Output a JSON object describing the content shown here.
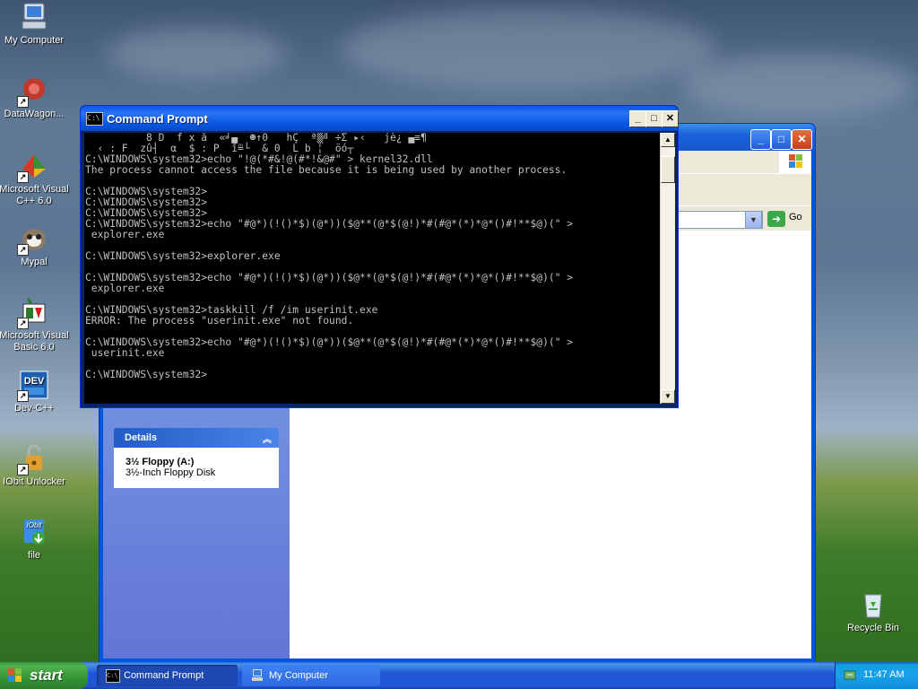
{
  "desktop": {
    "icons": [
      {
        "label": "My Computer",
        "icon": "my-computer-icon"
      },
      {
        "label": "DataWagon...",
        "icon": "datawagon-icon"
      },
      {
        "label": "Microsoft Visual C++ 6.0",
        "icon": "visual-cpp-icon"
      },
      {
        "label": "Mypal",
        "icon": "mypal-icon"
      },
      {
        "label": "Microsoft Visual Basic 6.0",
        "icon": "visual-basic-icon"
      },
      {
        "label": "Dev-C++",
        "icon": "devcpp-icon"
      },
      {
        "label": "IObit Unlocker",
        "icon": "iobit-unlocker-icon"
      },
      {
        "label": "file",
        "icon": "file-icon"
      },
      {
        "label": "Recycle Bin",
        "icon": "recycle-bin-icon"
      }
    ]
  },
  "cmd_window": {
    "title": "Command Prompt",
    "icon_text": "C:\\",
    "lines": [
      "          8 D  f x å  «╛▄  ☻↑0   hÇ  ª▒╝ ÷Σ ▸‹   jè¿ ▄≡¶",
      "  ‹ : F  zû┤  α  $ : P  î≞└  & 0  L b ╎  öó┬  ",
      "C:\\WINDOWS\\system32>echo \"!@(*#&!@(#*!&@#\" > kernel32.dll",
      "The process cannot access the file because it is being used by another process.",
      "",
      "C:\\WINDOWS\\system32>",
      "C:\\WINDOWS\\system32>",
      "C:\\WINDOWS\\system32>",
      "C:\\WINDOWS\\system32>echo \"#@*)(!()*$)(@*))($@**(@*$(@!)*#(#@*(*)*@*()#!**$@)(\" >",
      " explorer.exe",
      "",
      "C:\\WINDOWS\\system32>explorer.exe",
      "",
      "C:\\WINDOWS\\system32>echo \"#@*)(!()*$)(@*))($@**(@*$(@!)*#(#@*(*)*@*()#!**$@)(\" >",
      " explorer.exe",
      "",
      "C:\\WINDOWS\\system32>taskkill /f /im userinit.exe",
      "ERROR: The process \"userinit.exe\" not found.",
      "",
      "C:\\WINDOWS\\system32>echo \"#@*)(!()*$)(@*))($@**(@*$(@!)*#(#@*(*)*@*()#!**$@)(\" >",
      " userinit.exe",
      "",
      "C:\\WINDOWS\\system32>"
    ],
    "minimize": "_",
    "maximize": "□",
    "close": "✕"
  },
  "explorer_window": {
    "address_go": "Go",
    "details": {
      "header": "Details",
      "name": "3½ Floppy (A:)",
      "type": "3½-Inch Floppy Disk"
    }
  },
  "taskbar": {
    "start_label": "start",
    "buttons": [
      {
        "label": "Command Prompt",
        "active": true
      },
      {
        "label": "My Computer",
        "active": false
      }
    ],
    "clock": "11:47 AM"
  }
}
